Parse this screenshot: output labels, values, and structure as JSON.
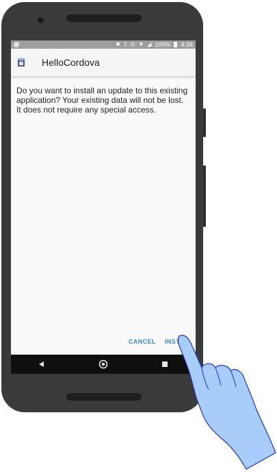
{
  "status_bar": {
    "battery_percent": "100%",
    "time": "4:34"
  },
  "app_bar": {
    "title": "HelloCordova",
    "icon": "android-package-icon"
  },
  "dialog": {
    "message": "Do you want to install an update to this existing application? Your existing data will not be lost. It does not require any special access.",
    "cancel_label": "CANCEL",
    "install_label": "INSTALL"
  },
  "nav_bar": {
    "icons": [
      "back-icon",
      "home-icon",
      "recents-icon"
    ]
  },
  "colors": {
    "accent": "#3b84d1",
    "status_bar": "#9e9e9e",
    "nav_bar": "#0f0f0f",
    "hand_fill": "#a9cdfb",
    "hand_stroke": "#2430c8"
  }
}
